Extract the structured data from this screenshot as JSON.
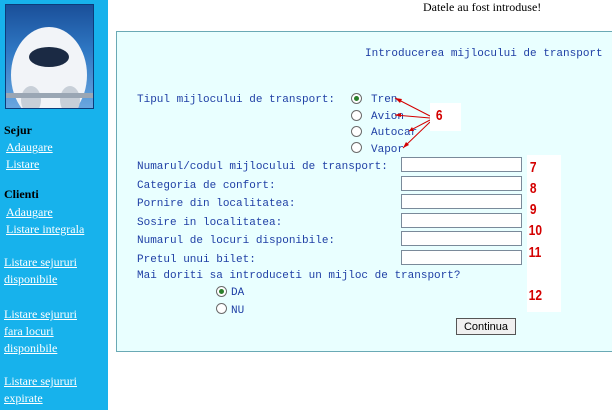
{
  "status_message": "Datele au fost introduse!",
  "sidebar": {
    "sections": [
      {
        "title": "Sejur",
        "links": [
          "Adaugare",
          "Listare"
        ]
      },
      {
        "title": "Clienti",
        "links": [
          "Adaugare",
          "Listare integrala"
        ]
      }
    ],
    "extra_links": [
      [
        "Listare sejururi",
        "disponibile"
      ],
      [
        "Listare sejururi",
        "fara locuri",
        "disponibile"
      ],
      [
        "Listare sejururi",
        "expirate"
      ]
    ]
  },
  "form": {
    "title": "Introducerea mijlocului de transport",
    "type_label": "Tipul mijlocului de transport:",
    "type_options": [
      "Tren",
      "Avion",
      "Autocar",
      "Vapor"
    ],
    "type_selected": "Tren",
    "fields": [
      {
        "label": "Numarul/codul mijlocului de transport:",
        "value": ""
      },
      {
        "label": "Categoria de confort:",
        "value": ""
      },
      {
        "label": "Pornire din localitatea:",
        "value": ""
      },
      {
        "label": "Sosire in localitatea:",
        "value": ""
      },
      {
        "label": "Numarul de locuri disponibile:",
        "value": ""
      },
      {
        "label": "Pretul unui bilet:",
        "value": ""
      }
    ],
    "question": "Mai doriti sa introduceti un mijloc de transport?",
    "answer_options": [
      "DA",
      "NU"
    ],
    "answer_selected": "DA",
    "submit_label": "Continua"
  },
  "annotations": {
    "color": "#d40000",
    "numbers": [
      "6",
      "7",
      "8",
      "9",
      "10",
      "11",
      "12"
    ]
  }
}
